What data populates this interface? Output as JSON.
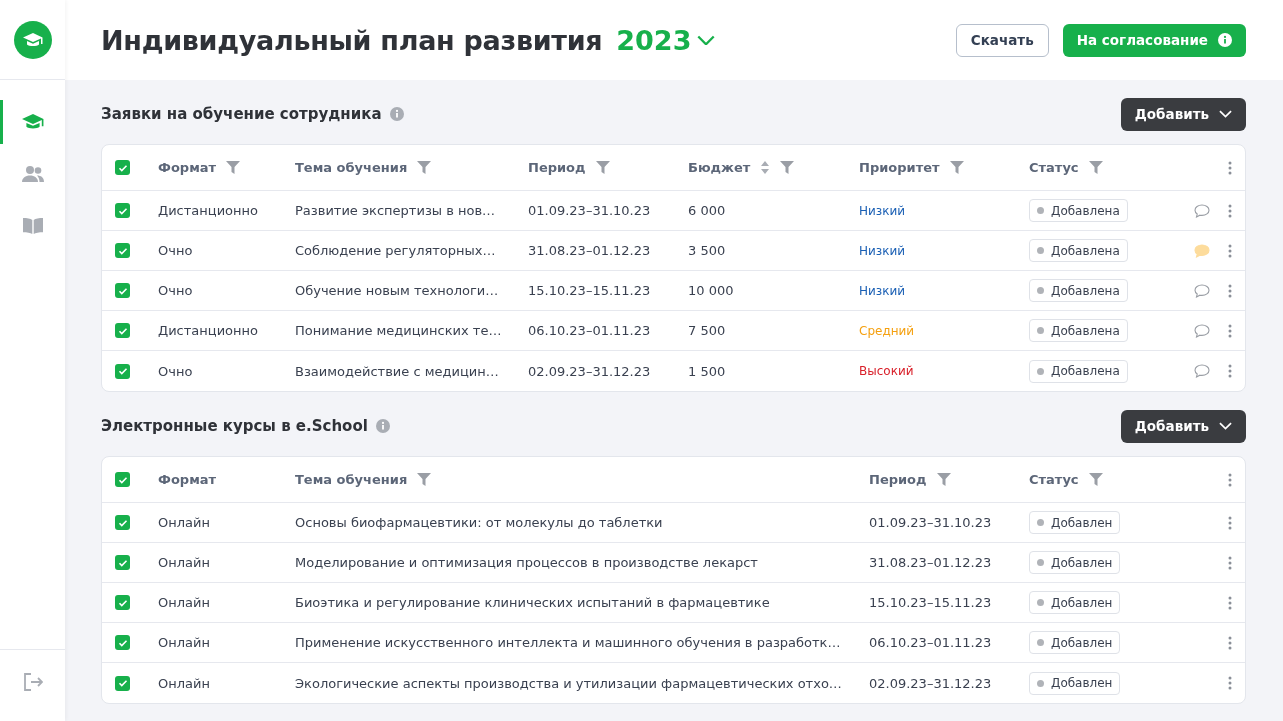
{
  "sidebar": {
    "items": [
      {
        "kind": "courses",
        "selected": true
      },
      {
        "kind": "people",
        "selected": false
      },
      {
        "kind": "library",
        "selected": false
      }
    ]
  },
  "header": {
    "title": "Индивидуальный план развития",
    "year": "2023",
    "buttons": [
      {
        "kind": "outline",
        "label": "Скачать"
      },
      {
        "kind": "primary",
        "label": "На согласование"
      }
    ]
  },
  "requests": {
    "title": "Заявки на обучение сотрудника",
    "add_button": "Добавить",
    "all_checked": true,
    "columns": [
      {
        "label": "Формат",
        "filter": true,
        "sort": false
      },
      {
        "label": "Тема обучения",
        "filter": true,
        "sort": false
      },
      {
        "label": "Период",
        "filter": true,
        "sort": false
      },
      {
        "label": "Бюджет",
        "filter": true,
        "sort": true
      },
      {
        "label": "Приоритет",
        "filter": true,
        "sort": false
      },
      {
        "label": "Статус",
        "filter": true,
        "sort": false
      }
    ],
    "rows": [
      {
        "checked": true,
        "format": "Дистанционно",
        "topic": "Развитие экспертизы в нов…",
        "period": "01.09.23–31.10.23",
        "budget": "6 000",
        "priority": "Низкий",
        "color": "#1a5fb4",
        "status": "Добавлена",
        "commented": false
      },
      {
        "checked": true,
        "format": "Очно",
        "topic": "Соблюдение регуляторных…",
        "period": "31.08.23–01.12.23",
        "budget": "3 500",
        "priority": "Низкий",
        "color": "#1a5fb4",
        "status": "Добавлена",
        "commented": true
      },
      {
        "checked": true,
        "format": "Очно",
        "topic": "Обучение новым технологи…",
        "period": "15.10.23–15.11.23",
        "budget": "10 000",
        "priority": "Низкий",
        "color": "#1a5fb4",
        "status": "Добавлена",
        "commented": false
      },
      {
        "checked": true,
        "format": "Дистанционно",
        "topic": "Понимание медицинских те…",
        "period": "06.10.23–01.11.23",
        "budget": "7 500",
        "priority": "Средний",
        "color": "#f5a00f",
        "status": "Добавлена",
        "commented": false
      },
      {
        "checked": true,
        "format": "Очно",
        "topic": "Взаимодействие с медицин…",
        "period": "02.09.23–31.12.23",
        "budget": "1 500",
        "priority": "Высокий",
        "color": "#d9202a",
        "status": "Добавлена",
        "commented": false
      }
    ]
  },
  "courses": {
    "title": "Электронные курсы в e.School",
    "add_button": "Добавить",
    "all_checked": true,
    "columns": [
      {
        "label": "Формат",
        "filter": false,
        "sort": false
      },
      {
        "label": "Тема обучения",
        "filter": true,
        "sort": false
      },
      {
        "label": "Период",
        "filter": true,
        "sort": false
      },
      {
        "label": "Статус",
        "filter": true,
        "sort": false
      }
    ],
    "rows": [
      {
        "checked": true,
        "format": "Онлайн",
        "topic": "Основы биофармацевтики: от молекулы до таблетки",
        "period": "01.09.23–31.10.23",
        "status": "Добавлен"
      },
      {
        "checked": true,
        "format": "Онлайн",
        "topic": "Моделирование и оптимизация процессов в производстве лекарст",
        "period": "31.08.23–01.12.23",
        "status": "Добавлен"
      },
      {
        "checked": true,
        "format": "Онлайн",
        "topic": "Биоэтика и регулирование клинических испытаний в фармацевтике",
        "period": "15.10.23–15.11.23",
        "status": "Добавлен"
      },
      {
        "checked": true,
        "format": "Онлайн",
        "topic": "Применение искусственного интеллекта и машинного обучения в разработк…",
        "period": "06.10.23–01.11.23",
        "status": "Добавлен"
      },
      {
        "checked": true,
        "format": "Онлайн",
        "topic": "Экологические аспекты производства и утилизации фармацевтических отхо…",
        "period": "02.09.23–31.12.23",
        "status": "Добавлен"
      }
    ]
  }
}
